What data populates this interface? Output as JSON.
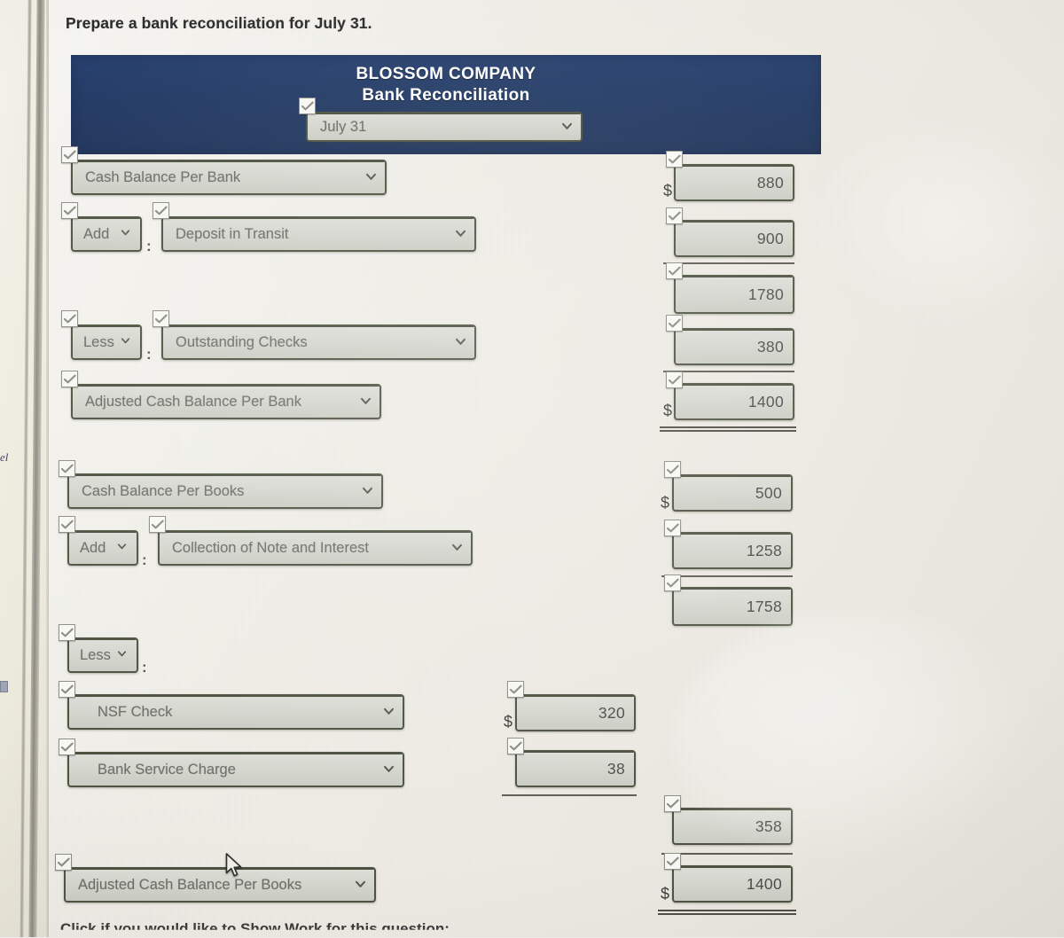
{
  "prompt": "Prepare a bank reconciliation for July 31.",
  "colors": {
    "banner_bg": "#223a64",
    "control_border": "#4d5340",
    "control_fill": "#d4d5cd",
    "control_text": "#6e6e68",
    "page_bg": "#eeece5"
  },
  "banner": {
    "company": "BLOSSOM COMPANY",
    "statement": "Bank Reconciliation",
    "date_select": {
      "value": "July 31",
      "icon": "chevron-down-icon"
    }
  },
  "icons": {
    "check": "check-icon",
    "chevron": "chevron-down-icon",
    "cursor": "mouse-pointer-icon"
  },
  "symbols": {
    "dollar": "$",
    "colon": ":"
  },
  "bank_section": {
    "rows": [
      {
        "label": "Cash Balance Per Bank",
        "amount": "880",
        "dollar": true
      },
      {
        "qualifier": "Add",
        "label": "Deposit in Transit",
        "amount": "900",
        "dollar": false
      },
      {
        "label": "",
        "amount": "1780",
        "dollar": false
      },
      {
        "qualifier": "Less",
        "label": "Outstanding Checks",
        "amount": "380",
        "dollar": false
      },
      {
        "label": "Adjusted Cash Balance Per Bank",
        "amount": "1400",
        "dollar": true
      }
    ]
  },
  "books_section": {
    "rows": [
      {
        "label": "Cash Balance Per Books",
        "amount": "500",
        "dollar": true
      },
      {
        "qualifier": "Add",
        "label": "Collection of Note and Interest",
        "amount": "1258",
        "dollar": false
      },
      {
        "label": "",
        "amount": "1758",
        "dollar": false
      },
      {
        "qualifier": "Less"
      },
      {
        "label": "NSF Check",
        "amount": "320",
        "dollar": true,
        "column": "middle"
      },
      {
        "label": "Bank Service Charge",
        "amount": "38",
        "dollar": false,
        "column": "middle"
      },
      {
        "label": "",
        "amount": "358",
        "dollar": false
      },
      {
        "label": "Adjusted Cash Balance Per Books",
        "amount": "1400",
        "dollar": true
      }
    ]
  },
  "footer": {
    "text": "Click if you would like to Show Work for this question:"
  },
  "chrome": {
    "tab_fragment": "el"
  }
}
